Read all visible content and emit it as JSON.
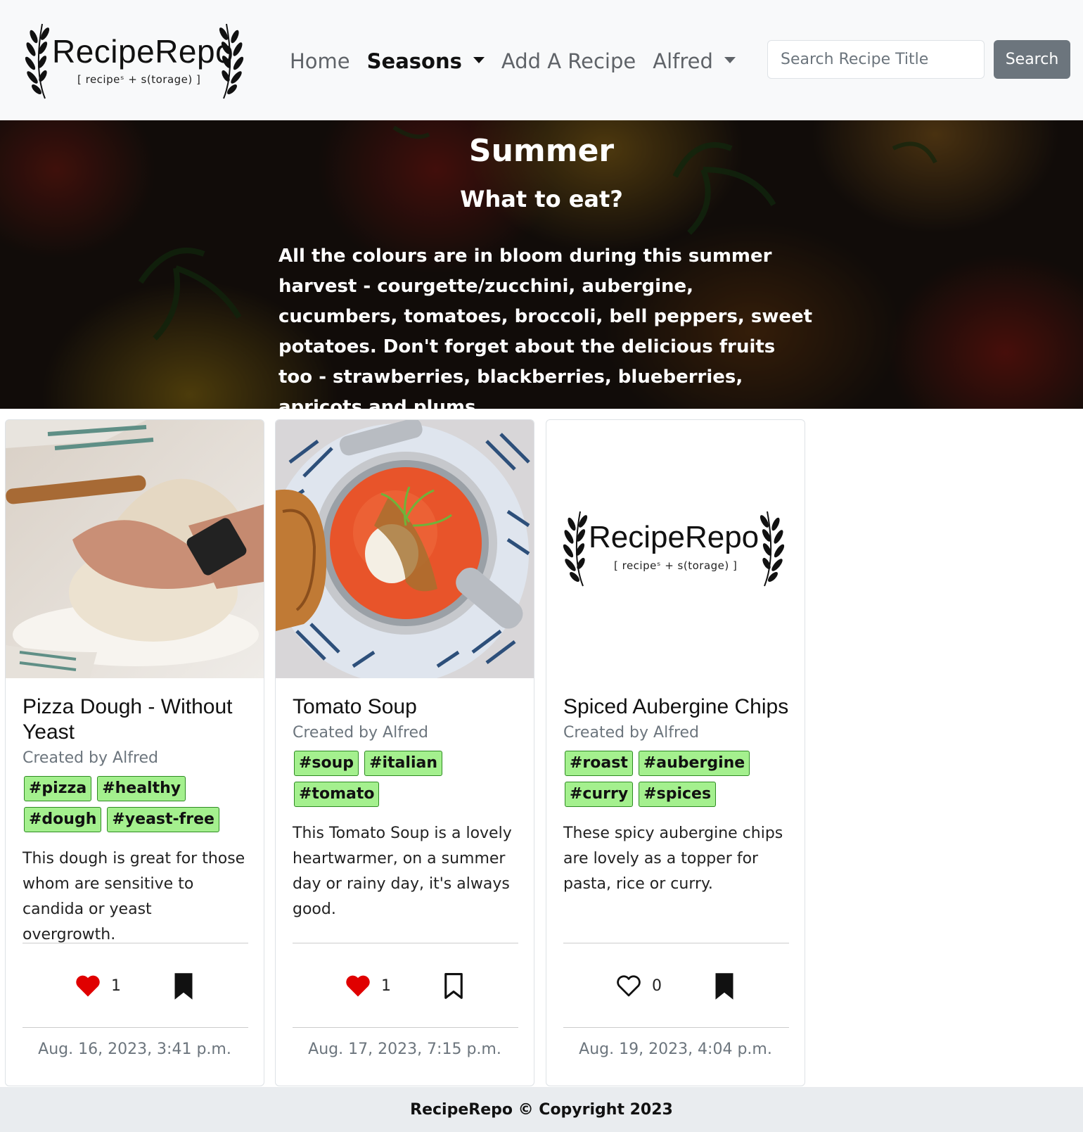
{
  "brand": {
    "name": "RecipeRepo",
    "tagline": "[ recipeˢ + s(torage) ]"
  },
  "nav": {
    "home": "Home",
    "seasons": "Seasons",
    "add_recipe": "Add A Recipe",
    "user": "Alfred"
  },
  "search": {
    "placeholder": "Search Recipe Title",
    "button": "Search"
  },
  "hero": {
    "title": "Summer",
    "subtitle": "What to eat?",
    "text": "All the colours are in bloom during this summer harvest - courgette/zucchini, aubergine, cucumbers, tomatoes, broccoli, bell peppers, sweet potatoes. Don't forget about the delicious fruits too - strawberries, blackberries, blueberries, apricots and plums."
  },
  "cards": [
    {
      "title": "Pizza Dough - Without Yeast",
      "author": "Created by Alfred",
      "tags": [
        "#pizza",
        "#healthy",
        "#dough",
        "#yeast-free"
      ],
      "description": "This dough is great for those whom are sensitive to candida or yeast overgrowth.",
      "likes": "1",
      "liked": true,
      "bookmarked": true,
      "date": "Aug. 16, 2023, 3:41 p.m.",
      "image": "pizza-dough-photo"
    },
    {
      "title": "Tomato Soup",
      "author": "Created by Alfred",
      "tags": [
        "#soup",
        "#italian",
        "#tomato"
      ],
      "description": "This Tomato Soup is a lovely heartwarmer, on a summer day or rainy day, it's always good.",
      "likes": "1",
      "liked": true,
      "bookmarked": false,
      "date": "Aug. 17, 2023, 7:15 p.m.",
      "image": "tomato-soup-photo"
    },
    {
      "title": "Spiced Aubergine Chips",
      "author": "Created by Alfred",
      "tags": [
        "#roast",
        "#aubergine",
        "#curry",
        "#spices"
      ],
      "description": "These spicy aubergine chips are lovely as a topper for pasta, rice or curry.",
      "likes": "0",
      "liked": false,
      "bookmarked": true,
      "date": "Aug. 19, 2023, 4:04 p.m.",
      "image": "reciperepo-logo-placeholder"
    }
  ],
  "colors": {
    "tag_bg": "#a4f08e",
    "like_red": "#e00000",
    "search_button": "#6c757d",
    "footer_bg": "#e9ecef"
  },
  "icons": {
    "like_filled": "heart-filled-icon",
    "like_empty": "heart-outline-icon",
    "bookmark_filled": "bookmark-filled-icon",
    "bookmark_empty": "bookmark-outline-icon",
    "caret": "caret-down-icon"
  },
  "footer": {
    "text": "RecipeRepo © Copyright 2023"
  }
}
